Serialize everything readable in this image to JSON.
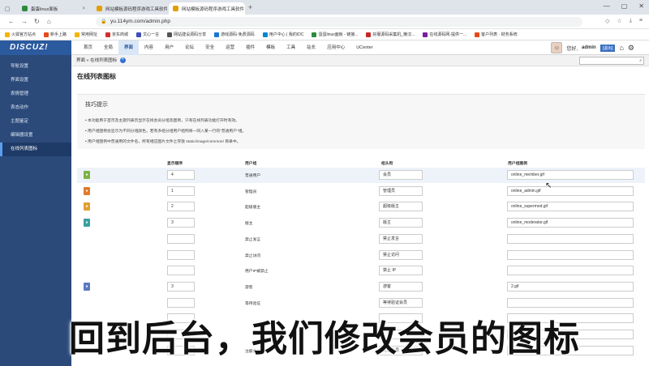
{
  "browser": {
    "tabs": [
      {
        "label": "蛋蛋linux面板",
        "active": false,
        "color": "#2b8a3e"
      },
      {
        "label": "网站模板源码程序游戏工具软件",
        "active": false,
        "color": "#e0a000"
      },
      {
        "label": "网站模板源码程序游戏工具软件",
        "active": true,
        "color": "#e0a000"
      }
    ],
    "url": "yu.114ym.com/admin.php",
    "bookmarks": [
      "火狐官方站点",
      "新手上路",
      "常用网址",
      "京东商城",
      "文心一言",
      "网站建设源码分享",
      "游戏源码·免费源码",
      "用户中心 | 我的IDC",
      "蛋蛋linux面板 - 链接...",
      "好服源码采集机_懒汉...",
      "在线源码网·提供一...",
      "客户列表 · 财务系统"
    ]
  },
  "header": {
    "logo": "DISCUZ!",
    "nav": [
      "首页",
      "全局",
      "界面",
      "内容",
      "用户",
      "论坛",
      "安全",
      "运营",
      "插件",
      "模板",
      "工具",
      "站长",
      "应用中心",
      "UCenter"
    ],
    "active_nav": "界面",
    "greeting": "您好,",
    "username": "admin",
    "logout": "[退出]"
  },
  "sidebar": {
    "items": [
      "导航设置",
      "界面设置",
      "表情管理",
      "表态动作",
      "主题鉴定",
      "编辑器设置",
      "在线列表图标"
    ],
    "active": "在线列表图标"
  },
  "breadcrumb": {
    "parent": "界面",
    "current": "在线列表图标"
  },
  "page_title": "在线列表图标",
  "tips": {
    "title": "技巧提示",
    "lines": [
      "本功能用于首页及主题列表页显示在线会员分组及图例，只有在线列表功能打开时有效。",
      "用户组图例会显示为不同分组颜色，若有多组分组用户组例将一同入某一行的\"普通用户\"组。",
      "用户组图例中普通用的文件名，所有相应图片文件之存放 static/image/common/ 目录中。"
    ]
  },
  "table": {
    "headers": [
      "显示顺序",
      "用户组",
      "组头衔",
      "用户组图例"
    ],
    "rows": [
      {
        "icon_color": "#7cb342",
        "order": "4",
        "group": "普通用户",
        "title": "会员",
        "image": "online_member.gif"
      },
      {
        "icon_color": "#e07a2e",
        "order": "1",
        "group": "管理员",
        "title": "管理员",
        "image": "online_admin.gif"
      },
      {
        "icon_color": "#e0a030",
        "order": "2",
        "group": "超级版主",
        "title": "超级版主",
        "image": "online_supermod.gif"
      },
      {
        "icon_color": "#3aa0a0",
        "order": "3",
        "group": "版主",
        "title": "版主",
        "image": "online_moderator.gif"
      },
      {
        "icon_color": "",
        "order": "",
        "group": "禁止发言",
        "title": "禁止发言",
        "image": ""
      },
      {
        "icon_color": "",
        "order": "",
        "group": "禁止访问",
        "title": "禁止访问",
        "image": ""
      },
      {
        "icon_color": "",
        "order": "",
        "group": "用户IP被禁止",
        "title": "禁止 IP",
        "image": ""
      },
      {
        "icon_color": "#5a7bc0",
        "order": "3",
        "group": "游客",
        "title": "游客",
        "image": "2.gif"
      },
      {
        "icon_color": "",
        "order": "",
        "group": "等待验证",
        "title": "等待验证会员",
        "image": ""
      },
      {
        "icon_color": "",
        "order": "",
        "group": "",
        "title": "",
        "image": ""
      },
      {
        "icon_color": "",
        "order": "",
        "group": "",
        "title": "",
        "image": ""
      },
      {
        "icon_color": "",
        "order": "",
        "group": "注册会员",
        "title": "注册会员",
        "image": ""
      }
    ]
  },
  "caption": "回到后台，我们修改会员的图标"
}
